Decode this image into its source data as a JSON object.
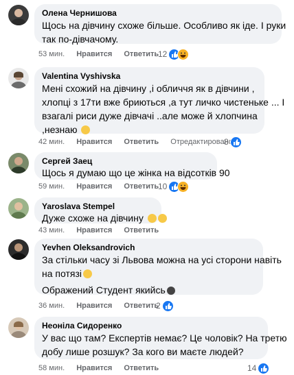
{
  "comments": [
    {
      "name": "Олена Чернишова",
      "lines": [
        "Щось на дівчину схоже більше. Особливо як іде. І руки",
        "так по-дівчачому."
      ],
      "time": "53 мин.",
      "like": "Нравится",
      "reply": "Ответить",
      "edited": "",
      "reactions": "12"
    },
    {
      "name": "Valentina Vyshivska",
      "lines": [
        "Мені схожий на дівчину ,і обличчя як в дівчини ,",
        "хлопці з 17ти вже бриються ,а тут личко чистеньке ... І",
        "взагалі риси дуже дівчачі ..але може й хлопчина",
        ",незнаю"
      ],
      "time": "42 мин.",
      "like": "Нравится",
      "reply": "Ответить",
      "edited": "Отредактировано",
      "reactions": "8"
    },
    {
      "name": "Сергей Заец",
      "lines": [
        "Щось я думаю що це жінка на відсотків 90"
      ],
      "time": "59 мин.",
      "like": "Нравится",
      "reply": "Ответить",
      "edited": "",
      "reactions": "10"
    },
    {
      "name": "Yaroslava Stempel",
      "lines": [
        "Дуже схоже на дівчину"
      ],
      "time": "43 мин.",
      "like": "Нравится",
      "reply": "Ответить",
      "edited": "",
      "reactions": ""
    },
    {
      "name": "Yevhen Oleksandrovich",
      "lines": [
        "За стільки часу зі Львова можна на усі сторони навіть",
        "на потязі"
      ],
      "extra": "Ображений Студент якийсь",
      "time": "36 мин.",
      "like": "Нравится",
      "reply": "Ответить",
      "edited": "",
      "reactions": "2"
    },
    {
      "name": "Неоніла Сидоренко",
      "lines": [
        "У вас що там? Експертів немає? Це чоловік? На третю",
        "добу лише розшук? За кого ви маєте людей?"
      ],
      "time": "58 мин.",
      "like": "Нравится",
      "reply": "Ответить",
      "edited": "",
      "reactions": "14"
    }
  ],
  "colors": {
    "bubble": "#f0f2f5",
    "meta": "#65676b",
    "like_blue": "#1877f2",
    "haha_yellow": "#f7b125"
  },
  "icons": [
    "like-reaction-icon",
    "haha-reaction-icon",
    "emoji-icon"
  ]
}
